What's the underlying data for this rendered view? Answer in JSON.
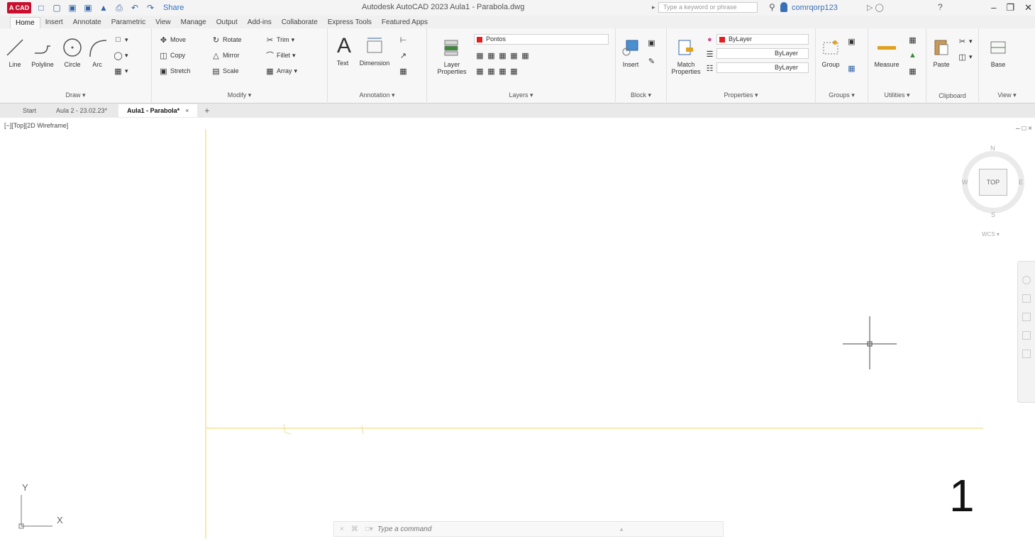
{
  "app": {
    "logo": "A CAD",
    "title": "Autodesk AutoCAD 2023  Aula1 - Parabola.dwg",
    "share": "Share",
    "search_placeholder": "Type a keyword or phrase",
    "user": "comrqorp123",
    "help": "?"
  },
  "ribbon_tabs": [
    "Home",
    "Insert",
    "Annotate",
    "Parametric",
    "View",
    "Manage",
    "Output",
    "Add-ins",
    "Collaborate",
    "Express Tools",
    "Featured Apps"
  ],
  "draw": {
    "title": "Draw ▾",
    "line": "Line",
    "polyline": "Polyline",
    "circle": "Circle",
    "arc": "Arc"
  },
  "modify": {
    "title": "Modify ▾",
    "move": "Move",
    "rotate": "Rotate",
    "trim": "Trim",
    "copy": "Copy",
    "mirror": "Mirror",
    "fillet": "Fillet",
    "stretch": "Stretch",
    "scale": "Scale",
    "array": "Array"
  },
  "annotation": {
    "title": "Annotation ▾",
    "text": "Text",
    "dimension": "Dimension"
  },
  "layers": {
    "title": "Layers ▾",
    "layer_properties": "Layer Properties",
    "current_layer": "Pontos"
  },
  "block": {
    "title": "Block ▾",
    "insert": "Insert"
  },
  "properties": {
    "title": "Properties ▾",
    "match": "Match Properties",
    "color": "ByLayer",
    "linetype": "ByLayer",
    "lineweight": "ByLayer"
  },
  "groups": {
    "title": "Groups ▾",
    "group": "Group"
  },
  "utilities": {
    "title": "Utilities ▾",
    "measure": "Measure"
  },
  "clipboard": {
    "title": "Clipboard",
    "paste": "Paste"
  },
  "view_panel": {
    "title": "View ▾",
    "base": "Base"
  },
  "doc_tabs": {
    "start": "Start",
    "aula2": "Aula 2 - 23.02.23*",
    "active": "Aula1 - Parabola*",
    "close": "×",
    "new": "+"
  },
  "viewport": {
    "label": "[−][Top][2D Wireframe]",
    "controls": "– □ ×"
  },
  "viewcube": {
    "top": "TOP",
    "n": "N",
    "s": "S",
    "e": "E",
    "w": "W",
    "wcs": "WCS ▾"
  },
  "ucs": {
    "y": "Y",
    "x": "X"
  },
  "overlay_number": "1",
  "command": {
    "close": "×",
    "settings": "⌘",
    "recent": "□▾",
    "placeholder": "Type a command",
    "arrow": "▴"
  },
  "colors": {
    "axis": "#f2e29a",
    "layer_red": "#e02020",
    "accent": "#2e72c4"
  }
}
